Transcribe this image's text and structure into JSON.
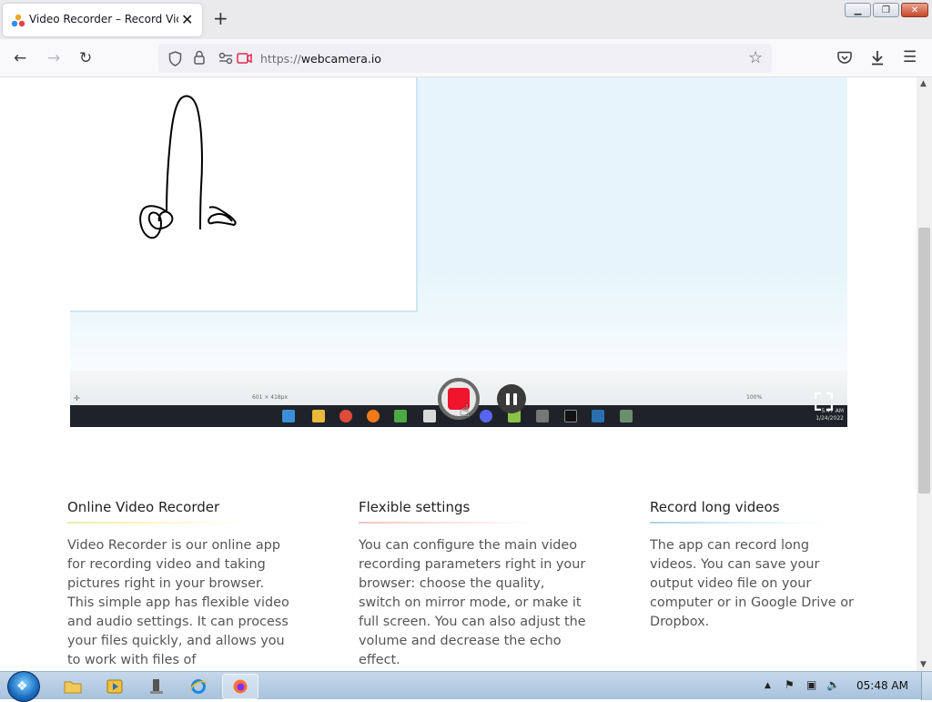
{
  "browser": {
    "tab_title": "Video Recorder – Record Video",
    "url_scheme": "https://",
    "url_host": "webcamera.io"
  },
  "recorder": {
    "canvas_size": "601 × 418px",
    "zoom": "100%",
    "clock_time": "5:47 AM",
    "clock_date": "1/24/2022",
    "record_color": "#f0142c"
  },
  "features": [
    {
      "title": "Online Video Recorder",
      "accent": "#dde8a0",
      "text": "Video Recorder is our online app for recording video and taking pictures right in your browser. This simple app has flexible video and audio settings. It can process your files quickly, and allows you to work with files of"
    },
    {
      "title": "Flexible settings",
      "accent": "#f0b8b8",
      "text": "You can configure the main video recording parameters right in your browser: choose the quality, switch on mirror mode, or make it full screen. You can also adjust the volume and decrease the echo effect."
    },
    {
      "title": "Record long videos",
      "accent": "#a8d0ea",
      "text": "The app can record long videos. You can save your output video file on your computer or in Google Drive or Dropbox."
    }
  ],
  "taskbar": {
    "time": "05:48 AM",
    "apps": [
      "file-explorer",
      "media-player",
      "server-manager",
      "internet-explorer",
      "firefox"
    ]
  }
}
